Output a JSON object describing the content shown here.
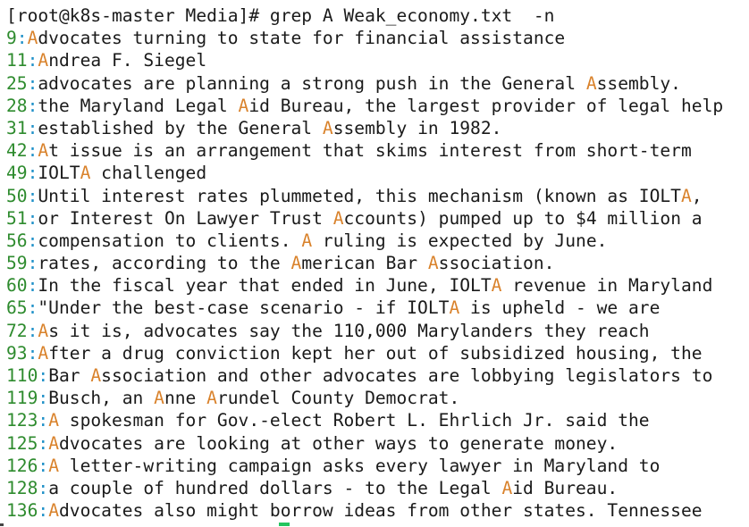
{
  "terminal": {
    "prompt_line": "[root@k8s-master Media]# grep A Weak_economy.txt  -n",
    "results": [
      {
        "line": "9",
        "segments": [
          {
            "t": "A",
            "m": true
          },
          {
            "t": "dvocates turning to state for financial assistance",
            "m": false
          }
        ]
      },
      {
        "line": "11",
        "segments": [
          {
            "t": "A",
            "m": true
          },
          {
            "t": "ndrea F. Siegel",
            "m": false
          }
        ]
      },
      {
        "line": "25",
        "segments": [
          {
            "t": "advocates are planning a strong push in the General ",
            "m": false
          },
          {
            "t": "A",
            "m": true
          },
          {
            "t": "ssembly.",
            "m": false
          }
        ]
      },
      {
        "line": "28",
        "segments": [
          {
            "t": "the Maryland Legal ",
            "m": false
          },
          {
            "t": "A",
            "m": true
          },
          {
            "t": "id Bureau, the largest provider of legal help",
            "m": false
          }
        ]
      },
      {
        "line": "31",
        "segments": [
          {
            "t": "established by the General ",
            "m": false
          },
          {
            "t": "A",
            "m": true
          },
          {
            "t": "ssembly in 1982.",
            "m": false
          }
        ]
      },
      {
        "line": "42",
        "segments": [
          {
            "t": "A",
            "m": true
          },
          {
            "t": "t issue is an arrangement that skims interest from short-term",
            "m": false
          }
        ]
      },
      {
        "line": "49",
        "segments": [
          {
            "t": "IOLT",
            "m": false
          },
          {
            "t": "A",
            "m": true
          },
          {
            "t": " challenged",
            "m": false
          }
        ]
      },
      {
        "line": "50",
        "segments": [
          {
            "t": "Until interest rates plummeted, this mechanism (known as IOLT",
            "m": false
          },
          {
            "t": "A",
            "m": true
          },
          {
            "t": ",",
            "m": false
          }
        ]
      },
      {
        "line": "51",
        "segments": [
          {
            "t": "or Interest On Lawyer Trust ",
            "m": false
          },
          {
            "t": "A",
            "m": true
          },
          {
            "t": "ccounts) pumped up to $4 million a",
            "m": false
          }
        ]
      },
      {
        "line": "56",
        "segments": [
          {
            "t": "compensation to clients. ",
            "m": false
          },
          {
            "t": "A",
            "m": true
          },
          {
            "t": " ruling is expected by June.",
            "m": false
          }
        ]
      },
      {
        "line": "59",
        "segments": [
          {
            "t": "rates, according to the ",
            "m": false
          },
          {
            "t": "A",
            "m": true
          },
          {
            "t": "merican Bar ",
            "m": false
          },
          {
            "t": "A",
            "m": true
          },
          {
            "t": "ssociation.",
            "m": false
          }
        ]
      },
      {
        "line": "60",
        "segments": [
          {
            "t": "In the fiscal year that ended in June, IOLT",
            "m": false
          },
          {
            "t": "A",
            "m": true
          },
          {
            "t": " revenue in Maryland",
            "m": false
          }
        ]
      },
      {
        "line": "65",
        "segments": [
          {
            "t": "\"Under the best-case scenario - if IOLT",
            "m": false
          },
          {
            "t": "A",
            "m": true
          },
          {
            "t": " is upheld - we are",
            "m": false
          }
        ]
      },
      {
        "line": "72",
        "segments": [
          {
            "t": "A",
            "m": true
          },
          {
            "t": "s it is, advocates say the 110,000 Marylanders they reach",
            "m": false
          }
        ]
      },
      {
        "line": "93",
        "segments": [
          {
            "t": "A",
            "m": true
          },
          {
            "t": "fter a drug conviction kept her out of subsidized housing, the",
            "m": false
          }
        ]
      },
      {
        "line": "110",
        "segments": [
          {
            "t": "Bar ",
            "m": false
          },
          {
            "t": "A",
            "m": true
          },
          {
            "t": "ssociation and other advocates are lobbying legislators to",
            "m": false
          }
        ]
      },
      {
        "line": "119",
        "segments": [
          {
            "t": "Busch, an ",
            "m": false
          },
          {
            "t": "A",
            "m": true
          },
          {
            "t": "nne ",
            "m": false
          },
          {
            "t": "A",
            "m": true
          },
          {
            "t": "rundel County Democrat.",
            "m": false
          }
        ]
      },
      {
        "line": "123",
        "segments": [
          {
            "t": "A",
            "m": true
          },
          {
            "t": " spokesman for Gov.-elect Robert L. Ehrlich Jr. said the",
            "m": false
          }
        ]
      },
      {
        "line": "125",
        "segments": [
          {
            "t": "A",
            "m": true
          },
          {
            "t": "dvocates are looking at other ways to generate money.",
            "m": false
          }
        ]
      },
      {
        "line": "126",
        "segments": [
          {
            "t": "A",
            "m": true
          },
          {
            "t": " letter-writing campaign asks every lawyer in Maryland to",
            "m": false
          }
        ]
      },
      {
        "line": "128",
        "segments": [
          {
            "t": "a couple of hundred dollars - to the Legal ",
            "m": false
          },
          {
            "t": "A",
            "m": true
          },
          {
            "t": "id Bureau.",
            "m": false
          }
        ]
      },
      {
        "line": "136",
        "segments": [
          {
            "t": "A",
            "m": true
          },
          {
            "t": "dvocates also might borrow ideas from other states. Tennessee",
            "m": false
          }
        ]
      }
    ],
    "separator": ":",
    "colors": {
      "text": "#1a1a1a",
      "line_number": "#2e8b2e",
      "separator": "#1e90c8",
      "match": "#d9822b",
      "cursor": "#22c55e",
      "background": "#ffffff"
    }
  }
}
